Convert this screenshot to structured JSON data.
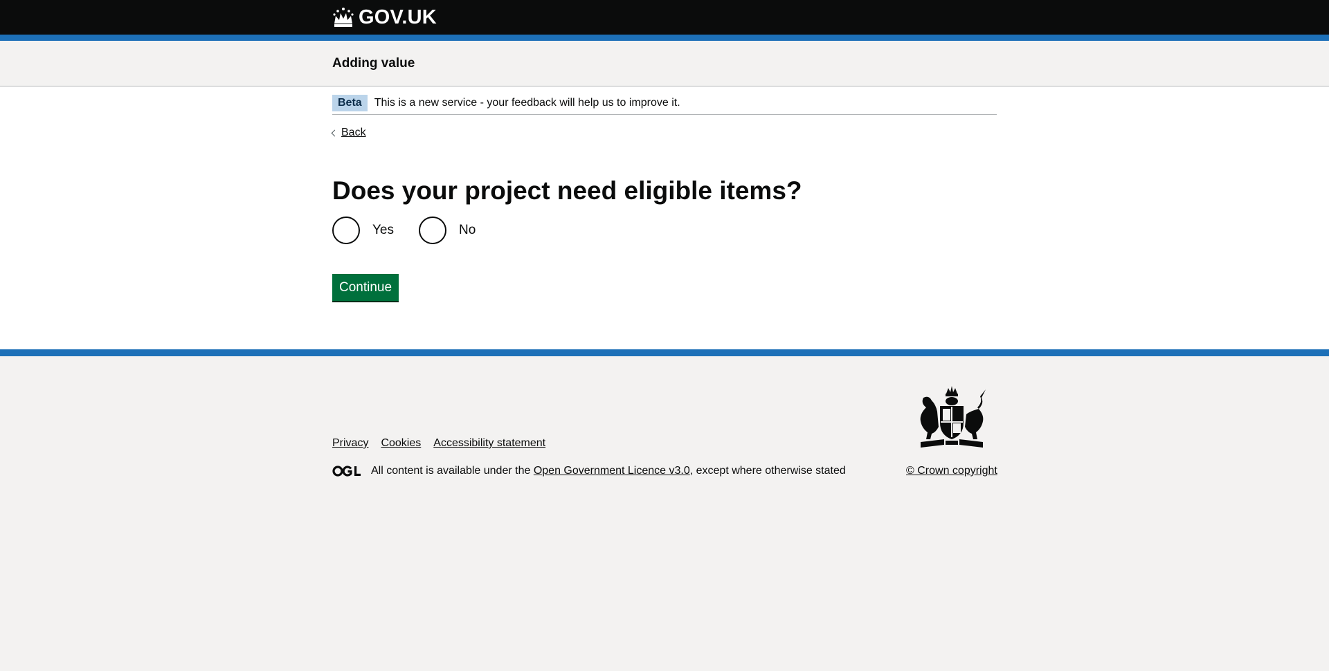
{
  "header": {
    "logo_text": "GOV.UK",
    "logo_icon": "crown-icon"
  },
  "service": {
    "name": "Adding value"
  },
  "phase_banner": {
    "tag": "Beta",
    "text": "This is a new service - your feedback will help us to improve it."
  },
  "back_link": {
    "label": "Back"
  },
  "question": {
    "title": "Does your project need eligible items?",
    "options": [
      {
        "label": "Yes",
        "selected": false
      },
      {
        "label": "No",
        "selected": false
      }
    ]
  },
  "continue_button": {
    "label": "Continue"
  },
  "footer": {
    "links": [
      "Privacy",
      "Cookies",
      "Accessibility statement"
    ],
    "licence_prefix": "All content is available under the",
    "licence_link": "Open Government Licence v3.0",
    "licence_suffix": ", except where otherwise stated",
    "copyright": "© Crown copyright"
  },
  "colors": {
    "header_bg": "#0b0c0c",
    "brand_blue": "#1d70b8",
    "button_green": "#00703c",
    "beta_tag_bg": "#bbd4ea",
    "footer_bg": "#f3f2f1"
  }
}
